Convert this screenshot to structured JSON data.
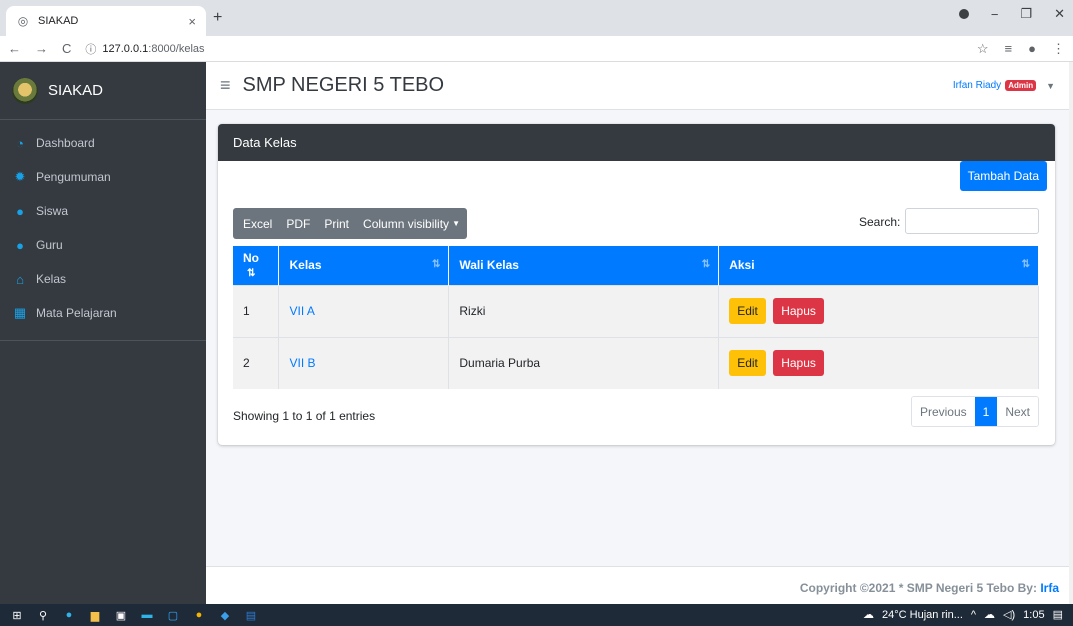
{
  "browser": {
    "tab_title": "SIAKAD",
    "tab_close": "×",
    "new_tab": "+",
    "url_host": "127.0.0.1",
    "url_rest": ":8000/kelas",
    "back": "←",
    "forward": "→",
    "reload": "C"
  },
  "sidebar": {
    "brand": "SIAKAD",
    "items": [
      {
        "label": "Dashboard",
        "icon": "dashboard-icon"
      },
      {
        "label": "Pengumuman",
        "icon": "gear-icon"
      },
      {
        "label": "Siswa",
        "icon": "user-icon"
      },
      {
        "label": "Guru",
        "icon": "users-icon"
      },
      {
        "label": "Kelas",
        "icon": "home-icon"
      },
      {
        "label": "Mata Pelajaran",
        "icon": "table-icon"
      }
    ]
  },
  "topbar": {
    "site_title": "SMP NEGERI 5 TEBO",
    "user_name": "Irfan Riady",
    "role_badge": "Admin"
  },
  "card": {
    "header": "Data Kelas",
    "add_button": "Tambah Data",
    "export_buttons": [
      "Excel",
      "PDF",
      "Print",
      "Column visibility"
    ],
    "search_label": "Search:",
    "search_value": "",
    "columns": [
      "No",
      "Kelas",
      "Wali Kelas",
      "Aksi"
    ],
    "rows": [
      {
        "no": "1",
        "kelas": "VII A",
        "wali": "Rizki",
        "edit": "Edit",
        "hapus": "Hapus"
      },
      {
        "no": "2",
        "kelas": "VII B",
        "wali": "Dumaria Purba",
        "edit": "Edit",
        "hapus": "Hapus"
      }
    ],
    "info": "Showing 1 to 1 of 1 entries",
    "pagination": {
      "previous": "Previous",
      "page": "1",
      "next": "Next"
    }
  },
  "footer": {
    "text": "Copyright ©2021 * SMP Negeri 5 Tebo By: ",
    "by": "Irfa"
  },
  "taskbar": {
    "weather": "24°C  Hujan rin...",
    "time": "1:05"
  },
  "colors": {
    "primary": "#007bff",
    "sidebar": "#343a40",
    "danger": "#dc3545",
    "warning": "#ffc107"
  }
}
